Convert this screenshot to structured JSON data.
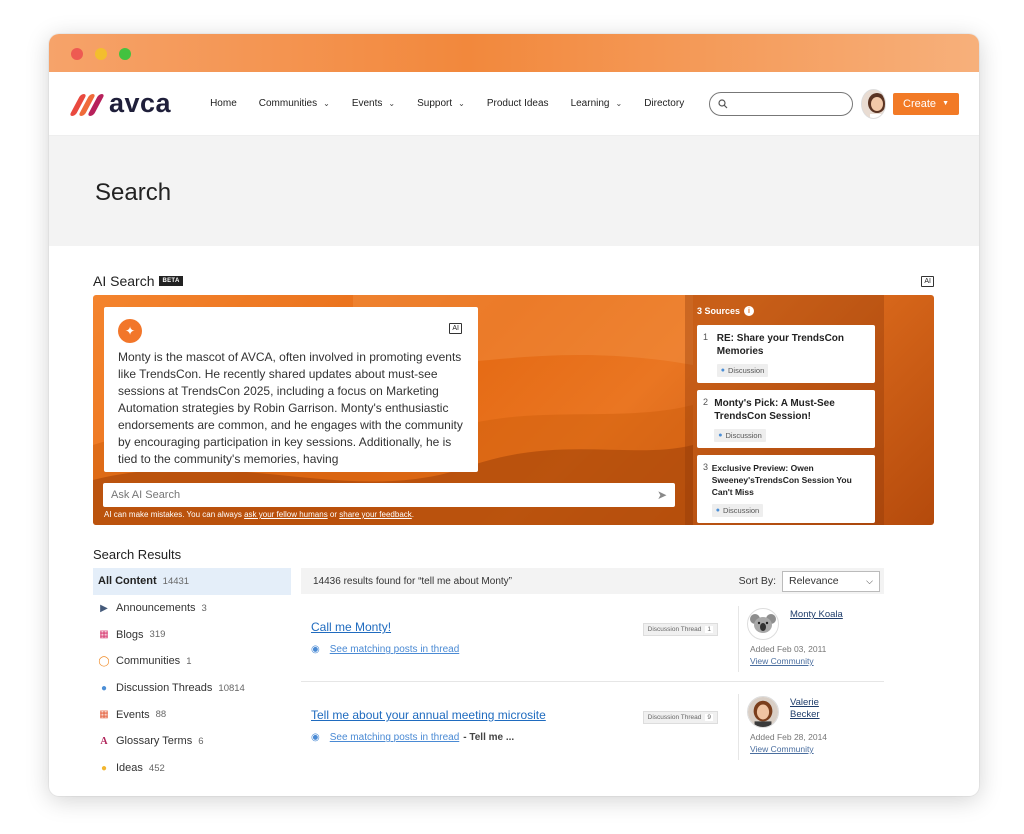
{
  "nav": {
    "logo_text": "avca",
    "items": [
      {
        "label": "Home",
        "has_dropdown": false
      },
      {
        "label": "Communities",
        "has_dropdown": true
      },
      {
        "label": "Events",
        "has_dropdown": true
      },
      {
        "label": "Support",
        "has_dropdown": true
      },
      {
        "label": "Product Ideas",
        "has_dropdown": false
      },
      {
        "label": "Learning",
        "has_dropdown": true
      },
      {
        "label": "Directory",
        "has_dropdown": false
      }
    ],
    "search_placeholder": "",
    "create_label": "Create",
    "brand_color": "#f27a26"
  },
  "page": {
    "title": "Search"
  },
  "ai_search": {
    "title": "AI Search",
    "beta_label": "BETA",
    "ai_badge": "AI",
    "answer": "Monty is the mascot of AVCA, often involved in promoting events like TrendsCon. He recently shared updates about must-see sessions at TrendsCon 2025, including a focus on Marketing Automation strategies by Robin Garrison. Monty's enthusiastic endorsements are common, and he engages with the community by encouraging participation in key sessions. Additionally, he is tied to the community's memories, having",
    "ask_placeholder": "Ask AI Search",
    "disclaimer_prefix": "AI can make mistakes. You can always",
    "disclaimer_link1": "ask your fellow humans",
    "disclaimer_mid": "or",
    "disclaimer_link2": "share your feedback",
    "disclaimer_suffix": ".",
    "sources_label": "3 Sources",
    "sources": [
      {
        "num": "1",
        "title": "RE: Share your TrendsCon Memories",
        "tag": "Discussion"
      },
      {
        "num": "2",
        "title": "Monty's Pick: A Must-See TrendsCon Session!",
        "tag": "Discussion"
      },
      {
        "num": "3",
        "title": "Exclusive Preview: Owen Sweeney'sTrendsCon Session You Can't Miss",
        "tag": "Discussion"
      }
    ]
  },
  "results": {
    "title": "Search Results",
    "facets": [
      {
        "label": "All Content",
        "count": "14431",
        "icon": "none",
        "active": true
      },
      {
        "label": "Announcements",
        "count": "3",
        "icon": "megaphone-icon"
      },
      {
        "label": "Blogs",
        "count": "319",
        "icon": "blog-icon"
      },
      {
        "label": "Communities",
        "count": "1",
        "icon": "ring-icon"
      },
      {
        "label": "Discussion Threads",
        "count": "10814",
        "icon": "chat-bubble-icon"
      },
      {
        "label": "Events",
        "count": "88",
        "icon": "calendar-icon"
      },
      {
        "label": "Glossary Terms",
        "count": "6",
        "icon": "glossary-a-icon"
      },
      {
        "label": "Ideas",
        "count": "452",
        "icon": "lightbulb-icon"
      }
    ],
    "summary": "14436 results found for “tell me about Monty”",
    "sort_label": "Sort By:",
    "sort_value": "Relevance",
    "items": [
      {
        "title": "Call me Monty!",
        "match_link": "See matching posts in thread",
        "match_extra": "",
        "type": "Discussion Thread",
        "type_count": "1",
        "author_name": "Monty Koala",
        "added": "Added Feb 03, 2011",
        "view": "View Community"
      },
      {
        "title": "Tell me about your annual meeting microsite",
        "match_link": "See matching posts in thread",
        "match_extra": "- Tell me ...",
        "type": "Discussion Thread",
        "type_count": "9",
        "author_name": "Valerie Becker",
        "added": "Added Feb 28, 2014",
        "view": "View Community"
      }
    ]
  }
}
